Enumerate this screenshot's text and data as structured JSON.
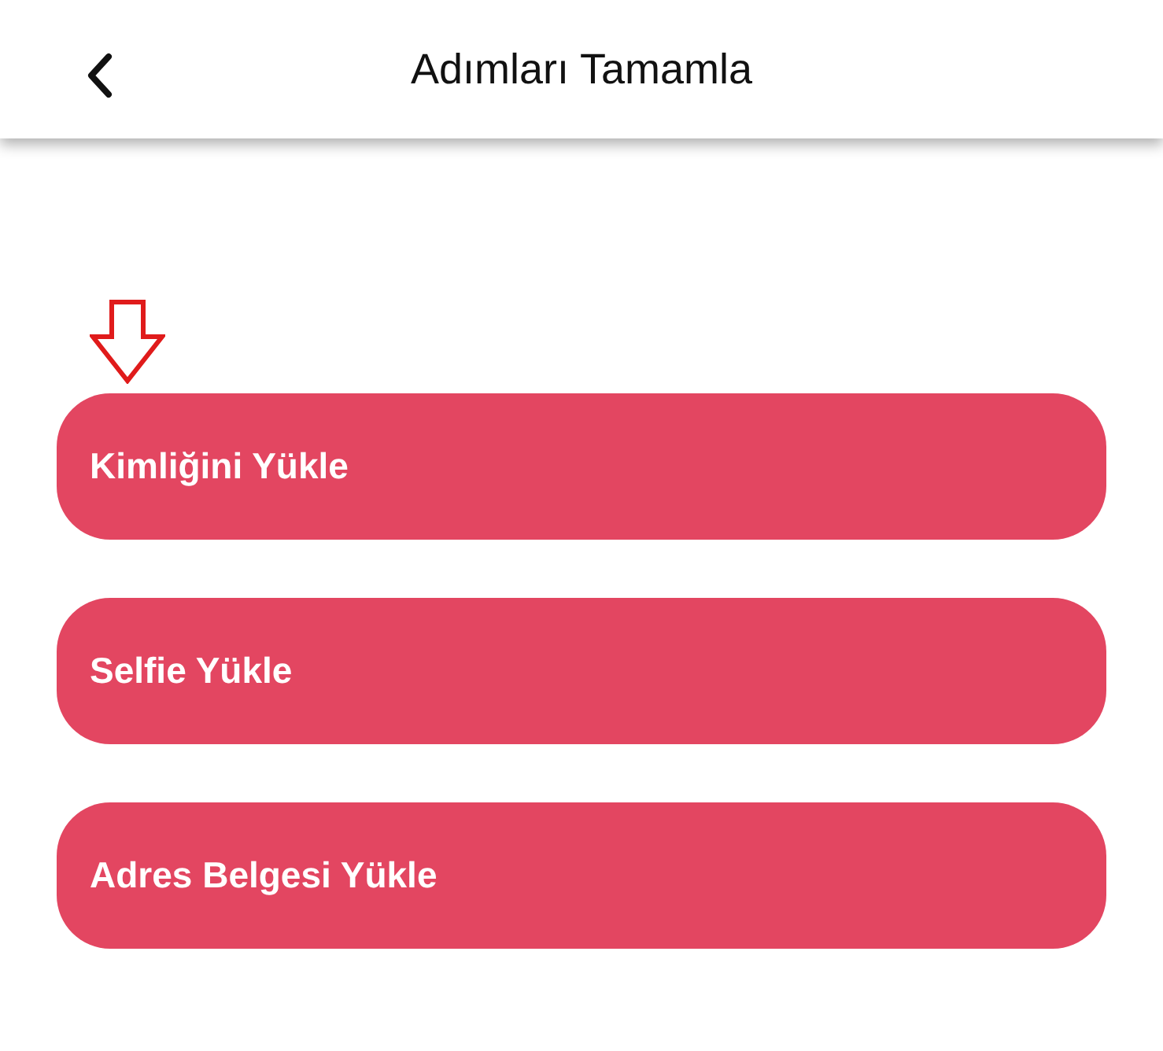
{
  "header": {
    "title": "Adımları Tamamla"
  },
  "steps": [
    {
      "label": "Kimliğini Yükle"
    },
    {
      "label": "Selfie Yükle"
    },
    {
      "label": "Adres Belgesi Yükle"
    }
  ]
}
